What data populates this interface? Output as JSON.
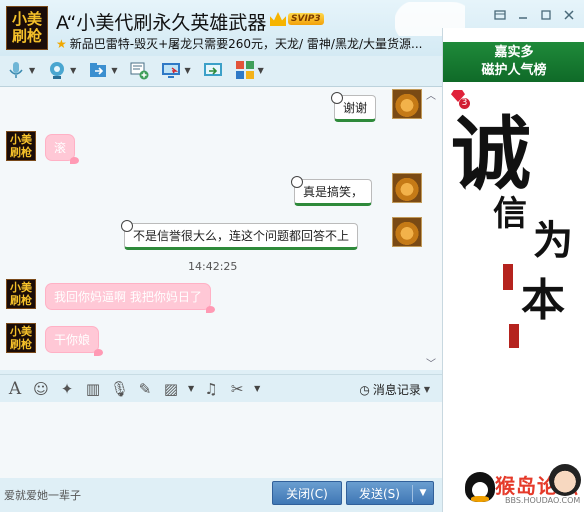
{
  "window": {
    "title": "A“小美代刷永久英雄武器",
    "svip": "SVIP3",
    "signature": "新品巴雷特-毁灭+屠龙只需要260元，天龙/ 雷神/黑龙/大量货源...",
    "avatar_text": [
      "小美",
      "刷枪"
    ]
  },
  "toolbar": {
    "items": [
      {
        "name": "voice-call-icon",
        "color": "#6fb6d6"
      },
      {
        "name": "video-call-icon",
        "color": "#4aa6d0"
      },
      {
        "name": "send-file-icon",
        "color": "#3b8fd0"
      },
      {
        "name": "create-group-icon",
        "color": "#3f9f5a"
      },
      {
        "name": "remote-desktop-icon",
        "color": "#2f79c6"
      },
      {
        "name": "share-screen-icon",
        "color": "#3ba0c8"
      },
      {
        "name": "apps-icon",
        "color": "#e2543a"
      }
    ]
  },
  "chat": {
    "messages": [
      {
        "from": "me",
        "text": "谢谢"
      },
      {
        "from": "them",
        "text": "滚"
      },
      {
        "from": "me",
        "text": "真是搞笑，"
      },
      {
        "from": "me",
        "text": "不是信誉很大么，连这个问题都回答不上"
      },
      {
        "from": "them",
        "text": "我回你妈逼啊 我把你妈日了"
      },
      {
        "from": "them",
        "text": "干你娘"
      }
    ],
    "timestamp": "14:42:25",
    "them_avatar_text": [
      "小美",
      "刷枪"
    ]
  },
  "input_toolbar": {
    "icons": [
      "font-icon",
      "emoji-icon",
      "magic-icon",
      "gif-icon",
      "voice-message-icon",
      "edit-icon",
      "image-icon",
      "music-icon",
      "screenshot-icon"
    ],
    "history_label": "消息记录"
  },
  "bottom": {
    "ad_text": "爱就爱她一辈子",
    "close_label": "关闭(C)",
    "send_label": "发送(S)"
  },
  "ad_panel": {
    "header_line1": "嘉实多",
    "header_line2": "磁护人气榜",
    "gem_count": "3",
    "calligraphy": [
      "诚",
      "信",
      "为",
      "本"
    ],
    "logo_text": "猴岛论坛",
    "logo_url": "BBS.HOUDAO.COM"
  }
}
